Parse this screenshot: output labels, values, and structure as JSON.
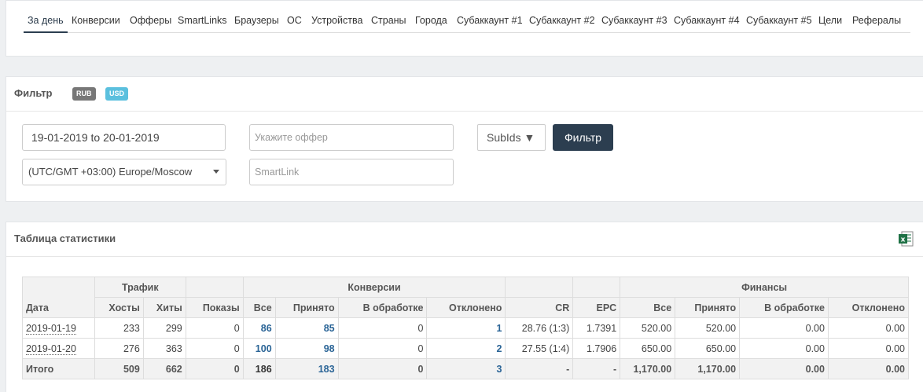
{
  "tabs": [
    "За день",
    "Конверсии",
    "Офферы",
    "SmartLinks",
    "Браузеры",
    "ОС",
    "Устройства",
    "Страны",
    "Города",
    "Субаккаунт #1",
    "Субаккаунт #2",
    "Субаккаунт #3",
    "Субаккаунт #4",
    "Субаккаунт #5",
    "Цели",
    "Рефералы"
  ],
  "filter": {
    "title": "Фильтр",
    "badges": [
      "RUB",
      "USD"
    ],
    "date_range": "19-01-2019 to 20-01-2019",
    "timezone": "(UTC/GMT +03:00) Europe/Moscow",
    "offer_placeholder": "Укажите оффер",
    "smartlink_placeholder": "SmartLink",
    "subids_label": "SubIds ▼",
    "submit_label": "Фильтр"
  },
  "stats": {
    "title": "Таблица статистики",
    "icon": "excel-export-icon",
    "group_headers": [
      "Трафик",
      "Конверсии",
      "Финансы"
    ],
    "columns": [
      "Дата",
      "Хосты",
      "Хиты",
      "Показы",
      "Все",
      "Принято",
      "В обработке",
      "Отклонено",
      "CR",
      "EPC",
      "Все",
      "Принято",
      "В обработке",
      "Отклонено"
    ],
    "rows": [
      [
        "2019-01-19",
        "233",
        "299",
        "0",
        "86",
        "85",
        "0",
        "1",
        "28.76 (1:3)",
        "1.7391",
        "520.00",
        "520.00",
        "0.00",
        "0.00"
      ],
      [
        "2019-01-20",
        "276",
        "363",
        "0",
        "100",
        "98",
        "0",
        "2",
        "27.55 (1:4)",
        "1.7906",
        "650.00",
        "650.00",
        "0.00",
        "0.00"
      ]
    ],
    "total": [
      "Итого",
      "509",
      "662",
      "0",
      "186",
      "183",
      "0",
      "3",
      "-",
      "-",
      "1,170.00",
      "1,170.00",
      "0.00",
      "0.00"
    ]
  },
  "colors": {
    "primary_button": "#2c3e50",
    "link": "#2a6496",
    "badge_usd": "#5bc0de",
    "badge_rub": "#777777",
    "excel": "#1e7145"
  }
}
